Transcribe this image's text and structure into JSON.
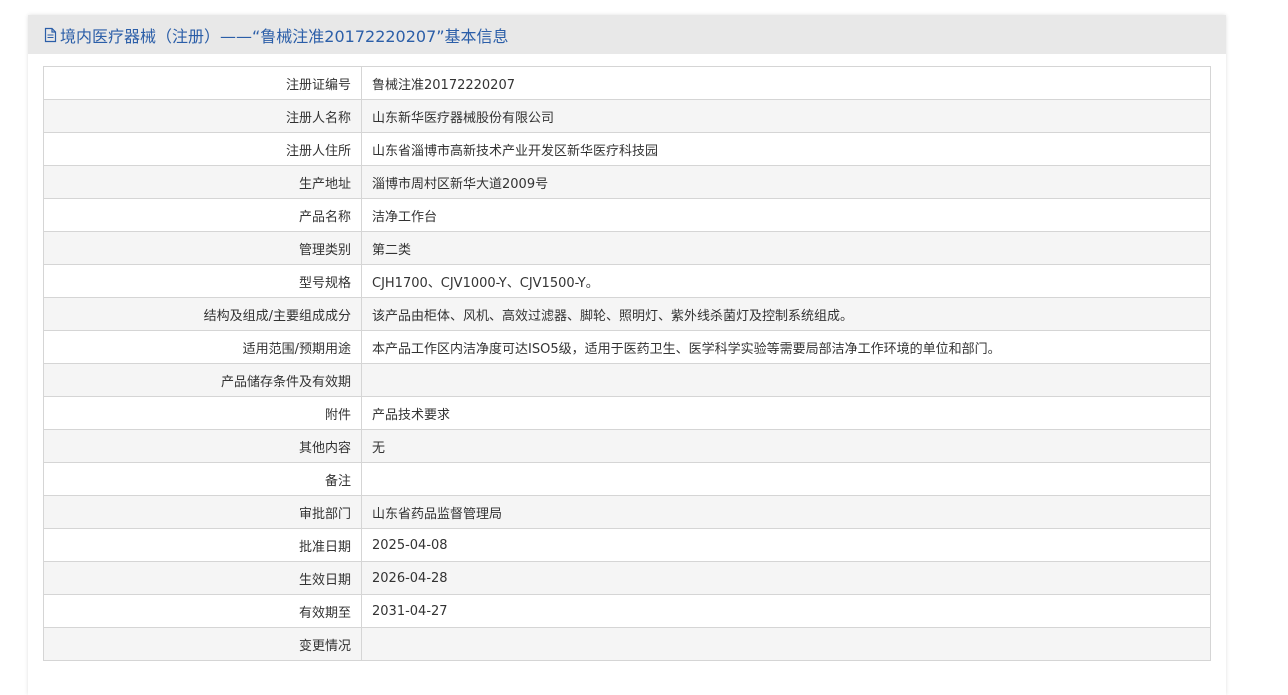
{
  "header": {
    "title": "境内医疗器械（注册）——“鲁械注准20172220207”基本信息",
    "icon": "document-icon",
    "title_color": "#2b5ea8"
  },
  "rows": [
    {
      "label": "注册证编号",
      "value": "鲁械注准20172220207"
    },
    {
      "label": "注册人名称",
      "value": "山东新华医疗器械股份有限公司"
    },
    {
      "label": "注册人住所",
      "value": "山东省淄博市高新技术产业开发区新华医疗科技园"
    },
    {
      "label": "生产地址",
      "value": "淄博市周村区新华大道2009号"
    },
    {
      "label": "产品名称",
      "value": "洁净工作台"
    },
    {
      "label": "管理类别",
      "value": "第二类"
    },
    {
      "label": "型号规格",
      "value": "CJH1700、CJV1000-Y、CJV1500-Y。"
    },
    {
      "label": "结构及组成/主要组成成分",
      "value": "该产品由柜体、风机、高效过滤器、脚轮、照明灯、紫外线杀菌灯及控制系统组成。"
    },
    {
      "label": "适用范围/预期用途",
      "value": "本产品工作区内洁净度可达ISO5级，适用于医药卫生、医学科学实验等需要局部洁净工作环境的单位和部门。"
    },
    {
      "label": "产品储存条件及有效期",
      "value": ""
    },
    {
      "label": "附件",
      "value": "产品技术要求"
    },
    {
      "label": "其他内容",
      "value": "无"
    },
    {
      "label": "备注",
      "value": ""
    },
    {
      "label": "审批部门",
      "value": "山东省药品监督管理局"
    },
    {
      "label": "批准日期",
      "value": "2025-04-08"
    },
    {
      "label": "生效日期",
      "value": "2026-04-28"
    },
    {
      "label": "有效期至",
      "value": "2031-04-27"
    },
    {
      "label": "变更情况",
      "value": ""
    }
  ]
}
